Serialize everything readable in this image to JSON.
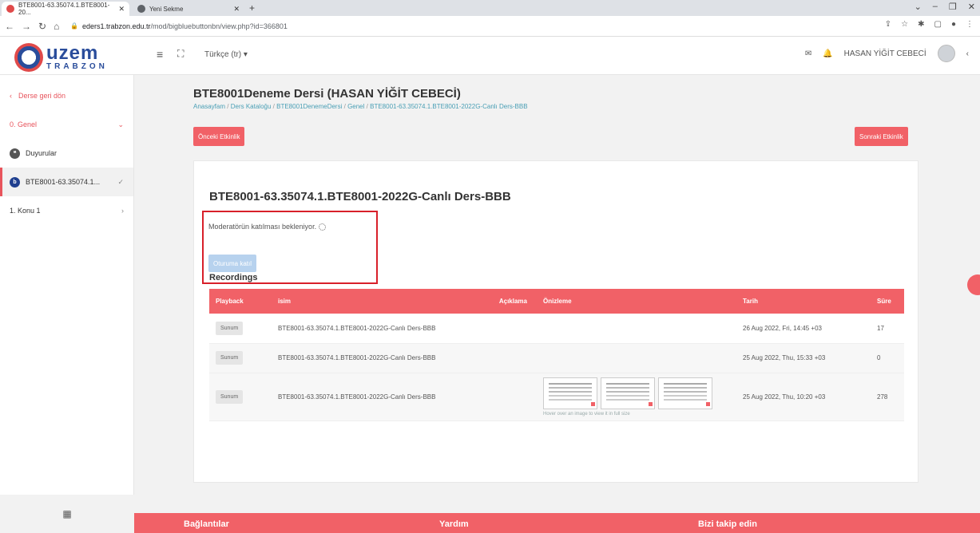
{
  "browser": {
    "tabs": [
      {
        "title": "BTE8001-63.35074.1.BTE8001-20..."
      },
      {
        "title": "Yeni Sekme"
      }
    ],
    "url_host": "eders1.trabzon.edu.tr",
    "url_path": "/mod/bigbluebuttonbn/view.php?id=366801"
  },
  "header": {
    "logo_main": "uzem",
    "logo_sub": "TRABZON",
    "language": "Türkçe (tr) ▾",
    "user_name": "HASAN YİĞİT CEBECİ"
  },
  "sidebar": {
    "back": "Derse geri dön",
    "items": [
      {
        "label": "0.  Genel"
      },
      {
        "label": "Duyurular"
      },
      {
        "label": "BTE8001-63.35074.1..."
      },
      {
        "label": "1.  Konu 1"
      }
    ]
  },
  "page": {
    "title": "BTE8001Deneme Dersi (HASAN YİĞİT CEBECİ)",
    "breadcrumb": [
      "Anasayfam",
      "Ders Kataloğu",
      "BTE8001DenemeDersi",
      "Genel",
      "BTE8001-63.35074.1.BTE8001-2022G-Canlı Ders-BBB"
    ],
    "prev_button": "Önceki Etkinlik",
    "next_button": "Sonraki Etkinlik"
  },
  "activity": {
    "title": "BTE8001-63.35074.1.BTE8001-2022G-Canlı Ders-BBB",
    "wait_message": "Moderatörün katılması bekleniyor.",
    "join_button": "Oturuma katıl",
    "recordings_title": "Recordings"
  },
  "recordings": {
    "headers": {
      "playback": "Playback",
      "name": "isim",
      "description": "Açıklama",
      "preview": "Önizleme",
      "date": "Tarih",
      "duration": "Süre"
    },
    "rows": [
      {
        "playback": "Sunum",
        "name": "BTE8001-63.35074.1.BTE8001-2022G-Canlı Ders-BBB",
        "date": "26 Aug 2022, Fri, 14:45 +03",
        "duration": "17"
      },
      {
        "playback": "Sunum",
        "name": "BTE8001-63.35074.1.BTE8001-2022G-Canlı Ders-BBB",
        "date": "25 Aug 2022, Thu, 15:33 +03",
        "duration": "0"
      },
      {
        "playback": "Sunum",
        "name": "BTE8001-63.35074.1.BTE8001-2022G-Canlı Ders-BBB",
        "date": "25 Aug 2022, Thu, 10:20 +03",
        "duration": "278",
        "hover_hint": "Hover over an image to view it in full size"
      }
    ]
  },
  "footer": {
    "links": "Bağlantılar",
    "help": "Yardım",
    "follow": "Bizi takip edin"
  },
  "colors": {
    "accent": "#f16167",
    "highlight_box": "#d8202a",
    "link": "#4a9fb5"
  }
}
